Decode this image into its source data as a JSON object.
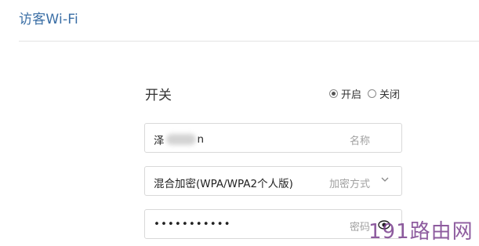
{
  "page": {
    "title": "访客Wi-Fi"
  },
  "switch": {
    "label": "开关",
    "options": [
      {
        "label": "开启",
        "selected": true
      },
      {
        "label": "关闭",
        "selected": false
      }
    ]
  },
  "ssid": {
    "value_start": "泽",
    "value_end": "n",
    "suffix": "名称"
  },
  "encryption": {
    "value": "混合加密(WPA/WPA2个人版)",
    "suffix": "加密方式"
  },
  "password": {
    "value": "•••••••••••",
    "suffix": "密码"
  },
  "watermark": {
    "text": "191路由网"
  }
}
